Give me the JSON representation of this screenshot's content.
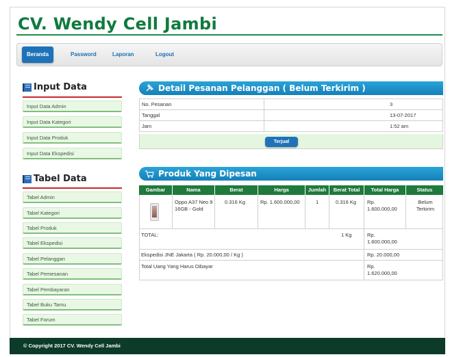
{
  "site": {
    "title": "CV. Wendy Cell Jambi"
  },
  "nav": {
    "items": [
      {
        "label": "Beranda",
        "active": true
      },
      {
        "label": "Password",
        "active": false
      },
      {
        "label": "Laporan",
        "active": false
      },
      {
        "label": "Logout",
        "active": false
      }
    ]
  },
  "sidebar": {
    "input_heading": "Input Data",
    "input_items": [
      {
        "label": "Input Data Admin"
      },
      {
        "label": "Input Data Kategori"
      },
      {
        "label": "Input Data Produk"
      },
      {
        "label": "Input Data Ekspedisi"
      }
    ],
    "table_heading": "Tabel Data",
    "table_items": [
      {
        "label": "Tabel Admin"
      },
      {
        "label": "Tabel Kategori"
      },
      {
        "label": "Tabel Produk"
      },
      {
        "label": "Tabel Ekspedisi"
      },
      {
        "label": "Tabel Pelanggan"
      },
      {
        "label": "Tabel Pemesanan"
      },
      {
        "label": "Tabel Pembayaran"
      },
      {
        "label": "Tabel Buku Tamu"
      },
      {
        "label": "Tabel Forum"
      }
    ]
  },
  "detail": {
    "heading": "Detail Pesanan Pelanggan ( Belum Terkirim )",
    "rows": [
      {
        "label": "No. Pesanan",
        "value": "3"
      },
      {
        "label": "Tanggal",
        "value": "13-07-2017"
      },
      {
        "label": "Jam",
        "value": "1:52 am"
      }
    ],
    "action_label": "Terjual"
  },
  "products": {
    "heading": "Produk Yang Dipesan",
    "columns": [
      "Gambar",
      "Nama",
      "Berat",
      "Harga",
      "Jumlah",
      "Berat Total",
      "Total Harga",
      "Status"
    ],
    "rows": [
      {
        "image": "phone-thumbnail",
        "name": "Oppo A37 Neo 9 16GB - Gold",
        "weight": "0.316 Kg",
        "price": "Rp. 1.600.000,00",
        "qty": "1",
        "total_weight": "0.316 Kg",
        "total_price": "Rp. 1.600.000,00",
        "status": "Belum Terkirim"
      }
    ],
    "total_label": "TOTAL:",
    "total_weight": "1 Kg",
    "total_price": "Rp. 1.600.000,00",
    "shipping_label": "Ekspedisi JNE Jakarta ( Rp. 20.000,00 / Kg )",
    "shipping_price": "Rp. 20.000,00",
    "grand_label": "Total Uang Yang Harus Dibayar",
    "grand_price": "Rp. 1.620.000,00"
  },
  "footer": {
    "text": "© Copyright 2017 CV. Wendy Cell Jambi"
  },
  "colors": {
    "brand_green": "#0f7a3f",
    "nav_blue": "#1e72b8",
    "header_blue": "#1a8fc8",
    "footer": "#0c3b2a"
  }
}
